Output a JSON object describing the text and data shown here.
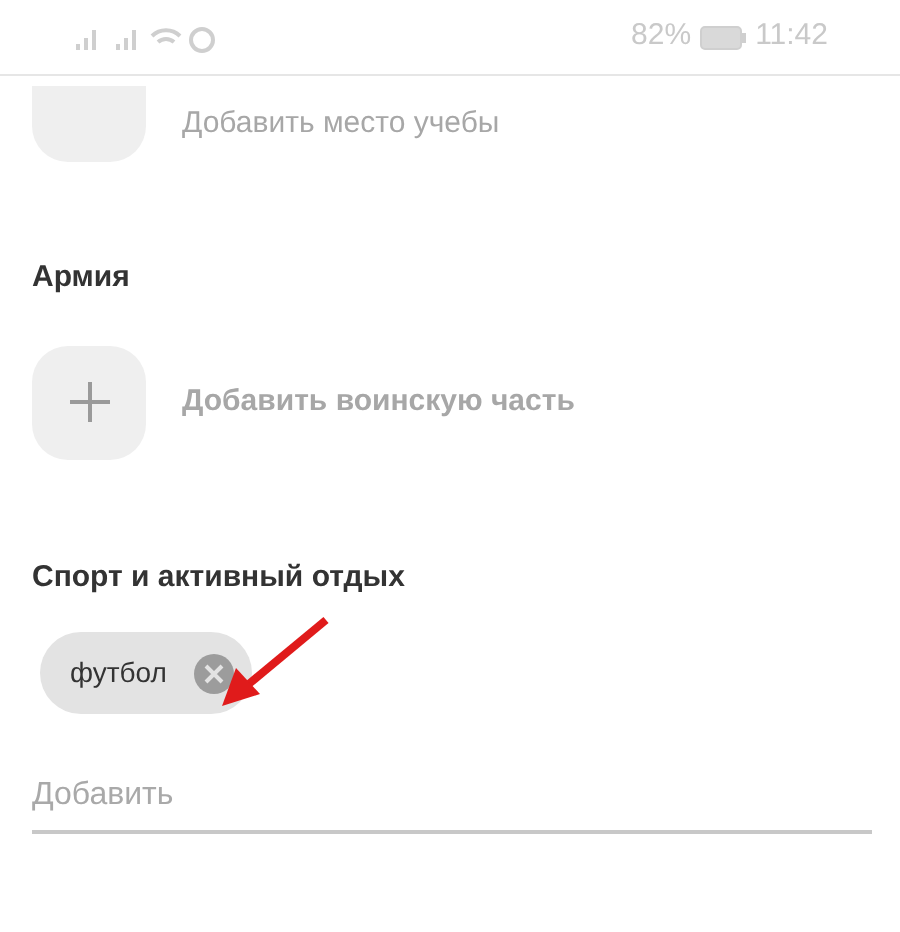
{
  "status_bar": {
    "battery_text": "82%",
    "time": "11:42"
  },
  "study": {
    "add_label": "Добавить место учебы"
  },
  "army": {
    "title": "Армия",
    "add_label": "Добавить воинскую часть"
  },
  "sport": {
    "title": "Спорт и активный отдых",
    "tags": [
      {
        "label": "футбол"
      }
    ],
    "field": {
      "placeholder": "Добавить"
    }
  }
}
